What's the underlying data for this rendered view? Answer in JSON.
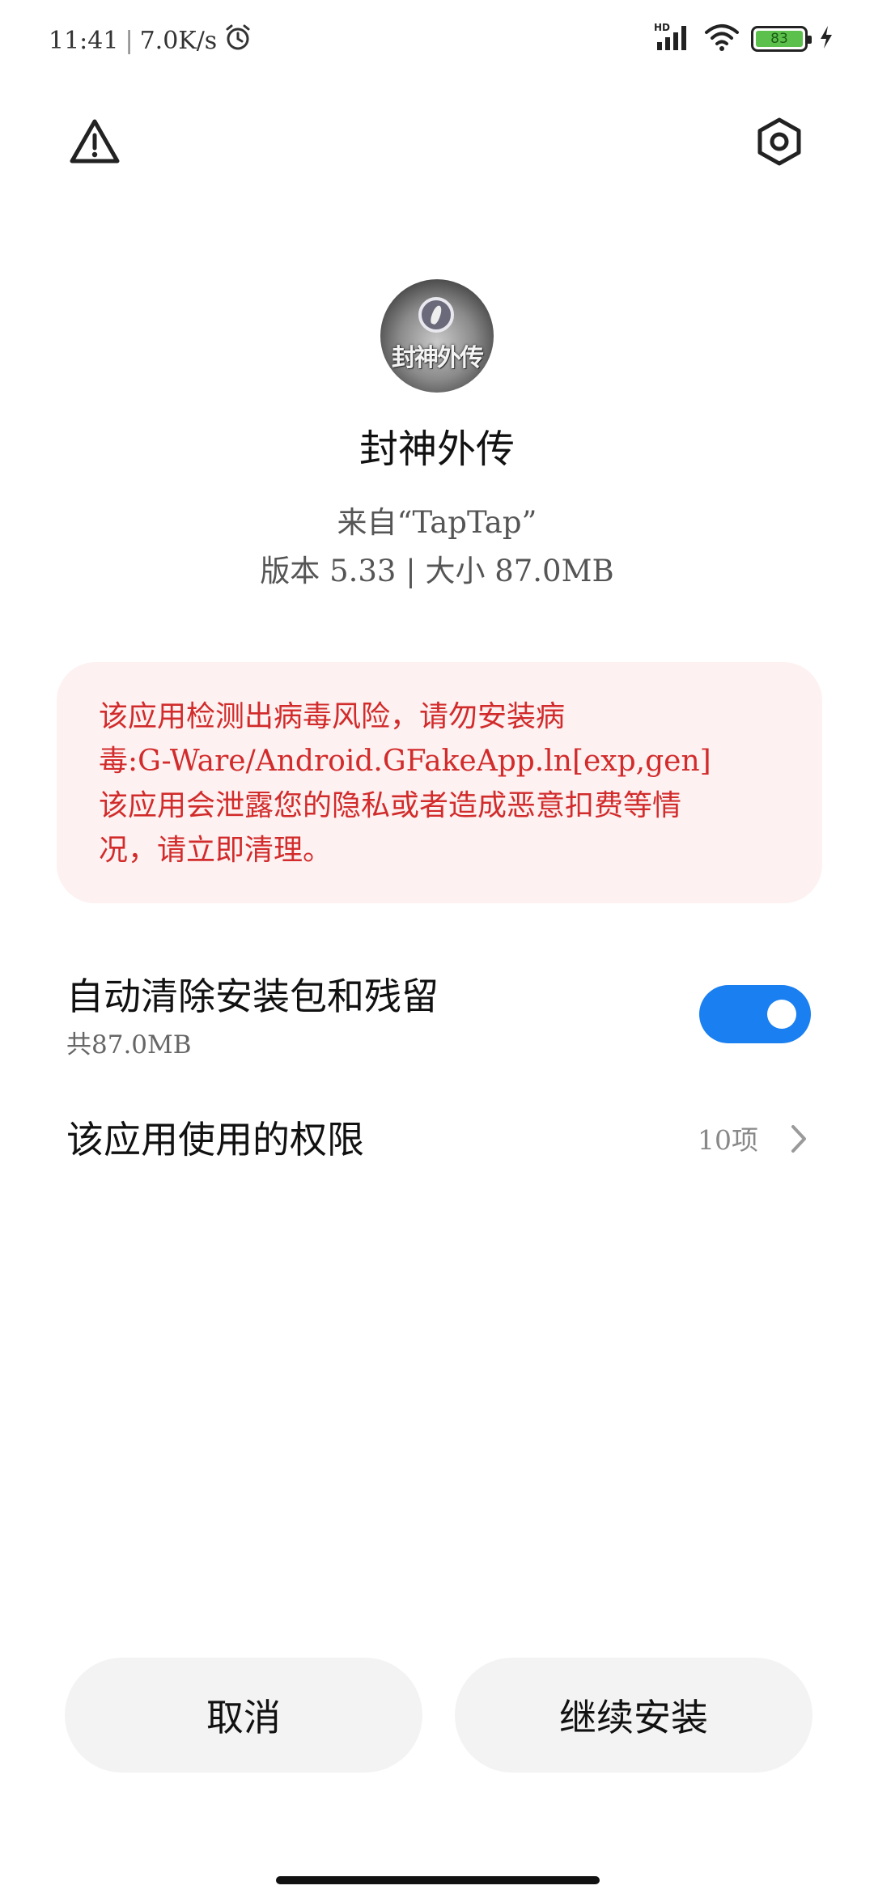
{
  "status_bar": {
    "time": "11:41",
    "separator": "|",
    "net_speed": "7.0K/s",
    "battery_level": "83",
    "network_label": "HD"
  },
  "app": {
    "name": "封神外传",
    "icon_text": "封神外传",
    "source": "来自“TapTap”",
    "meta": "版本 5.33 | 大小 87.0MB"
  },
  "warning": {
    "text": "该应用检测出病毒风险，请勿安装病\n毒:G-Ware/Android.GFakeApp.ln[exp,gen]\n该应用会泄露您的隐私或者造成恶意扣费等情\n况，请立即清理。",
    "color": "#d22b2b",
    "background": "#fdf1f1"
  },
  "auto_clean": {
    "title": "自动清除安装包和残留",
    "subtitle": "共87.0MB",
    "enabled": true,
    "accent": "#1a7ff0"
  },
  "permissions": {
    "title": "该应用使用的权限",
    "count": "10项"
  },
  "buttons": {
    "cancel": "取消",
    "continue": "继续安装"
  },
  "icons": {
    "top_left": "warning-icon",
    "top_right": "settings-icon",
    "status": [
      "alarm-icon",
      "cellular-signal-icon",
      "wifi-icon",
      "battery-icon",
      "charging-icon"
    ]
  }
}
